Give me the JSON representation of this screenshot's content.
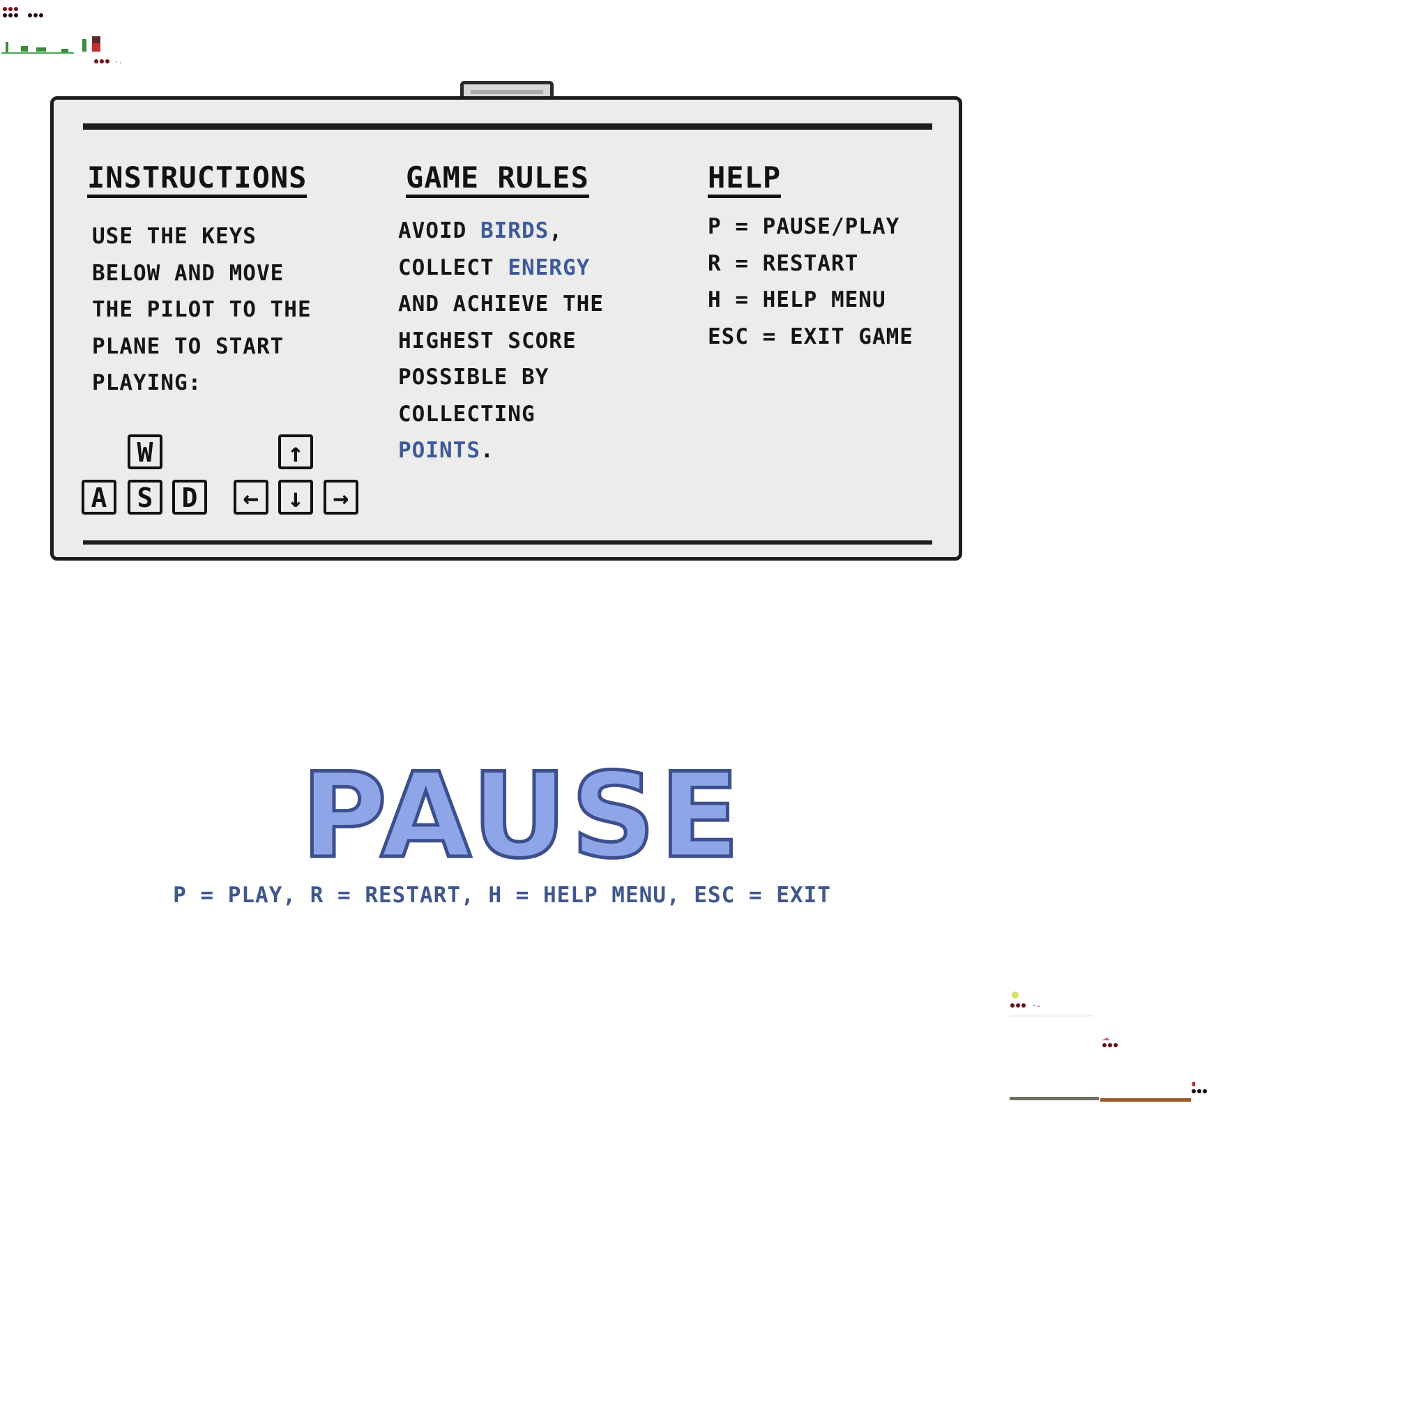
{
  "help_panel": {
    "instructions": {
      "title": "INSTRUCTIONS",
      "lines": [
        "USE THE KEYS",
        "BELOW AND MOVE",
        "THE PILOT TO THE",
        "PLANE TO START",
        "PLAYING:"
      ],
      "keys": {
        "w": "W",
        "a": "A",
        "s": "S",
        "d": "D",
        "up": "↑",
        "left": "←",
        "down": "↓",
        "right": "→"
      }
    },
    "game_rules": {
      "title": "GAME RULES",
      "line1_a": "AVOID ",
      "line1_b": "BIRDS",
      "line1_c": ",",
      "line2_a": "COLLECT ",
      "line2_b": "ENERGY",
      "line3": "AND ACHIEVE THE",
      "line4": "HIGHEST SCORE",
      "line5": "POSSIBLE BY",
      "line6": "COLLECTING",
      "line7_a": "POINTS",
      "line7_b": "."
    },
    "help": {
      "title": "HELP",
      "lines": [
        "P = PAUSE/PLAY",
        "R = RESTART",
        "H = HELP MENU",
        "ESC = EXIT GAME"
      ]
    }
  },
  "pause_screen": {
    "title": "PAUSE",
    "controls": "P = PLAY, R = RESTART, H = HELP MENU, ESC = EXIT"
  },
  "colors": {
    "panel_bg": "#ececec",
    "highlight": "#3e5a9a",
    "pause_fill": "#8ea6e8",
    "pause_outline": "#3d4f8c"
  }
}
